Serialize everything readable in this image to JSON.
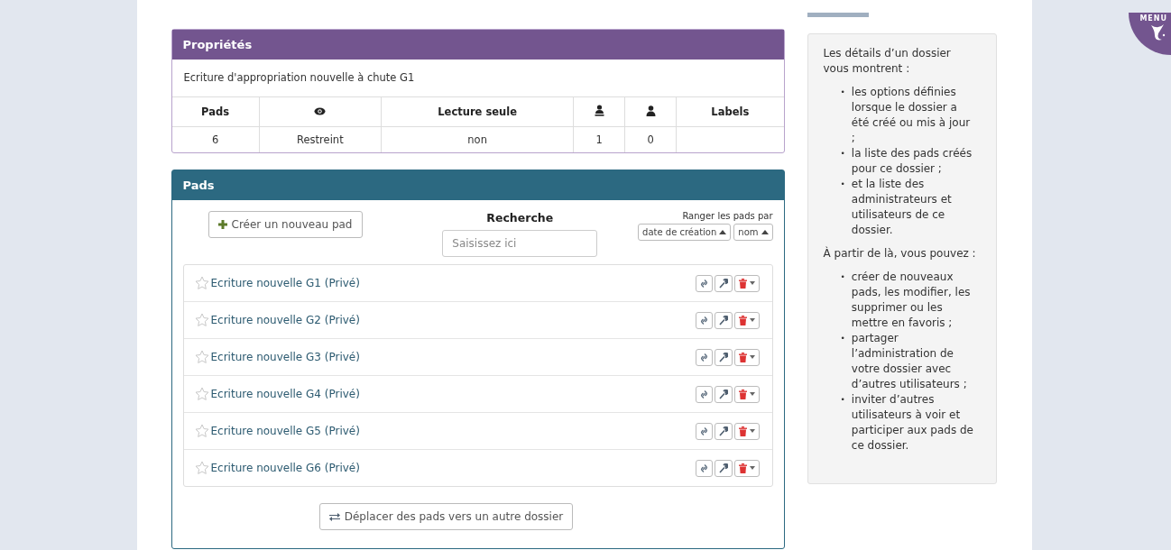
{
  "properties": {
    "title": "Propriétés",
    "description": "Ecriture d'appropriation nouvelle à chute G1",
    "columns": [
      {
        "kind": "text",
        "label": "Pads"
      },
      {
        "kind": "eye"
      },
      {
        "kind": "text",
        "label": "Lecture seule"
      },
      {
        "kind": "admin"
      },
      {
        "kind": "user"
      },
      {
        "kind": "text",
        "label": "Labels"
      }
    ],
    "row": [
      "6",
      "Restreint",
      "non",
      "1",
      "0"
    ]
  },
  "pads": {
    "title": "Pads",
    "create_button": "Créer un nouveau pad",
    "search": {
      "label": "Recherche",
      "placeholder": "Saisissez ici"
    },
    "sort": {
      "label": "Ranger les pads par",
      "options": [
        "date de création",
        "nom"
      ]
    },
    "items": [
      {
        "name": "Ecriture nouvelle G1 (Privé)",
        "favorite": false
      },
      {
        "name": "Ecriture nouvelle G2 (Privé)",
        "favorite": false
      },
      {
        "name": "Ecriture nouvelle G3 (Privé)",
        "favorite": false
      },
      {
        "name": "Ecriture nouvelle G4 (Privé)",
        "favorite": false
      },
      {
        "name": "Ecriture nouvelle G5 (Privé)",
        "favorite": false
      },
      {
        "name": "Ecriture nouvelle G6 (Privé)",
        "favorite": false
      }
    ],
    "move_button": "Déplacer des pads vers un autre dossier"
  },
  "help": {
    "bullet": "•",
    "intro": "Les détails d’un dossier vous montrent  :",
    "list1": [
      "les options définies lorsque le dossier a été créé ou mis à jour  ;",
      "la liste des pads créés pour ce dossier  ;",
      "et la liste des administrateurs et utilisateurs de ce dossier."
    ],
    "intro2": "À partir de là, vous pouvez  :",
    "list2": [
      "créer de nouveaux pads, les modifier, les supprimer ou les mettre en favoris  ;",
      "partager l’administration de votre dossier avec d’autres utilisateurs  ;",
      "inviter d’autres utilisateurs à voir et participer aux pads de ce dossier."
    ]
  },
  "menu": {
    "label": "MENU"
  }
}
